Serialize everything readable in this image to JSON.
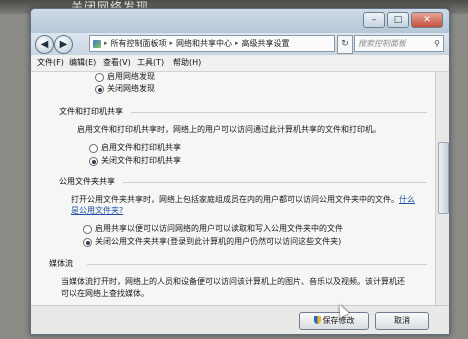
{
  "photo_caption": "，关闭网络发现",
  "window": {
    "caption_buttons": {
      "minimize": "–",
      "maximize": "□",
      "close": "✕"
    }
  },
  "nav": {
    "back": "◀",
    "forward": "▶"
  },
  "address": {
    "crumbs": [
      "所有控制面板项",
      "网络和共享中心",
      "高级共享设置"
    ],
    "separator": "▸",
    "refresh": "↻"
  },
  "search": {
    "placeholder": "搜索控制面板",
    "icon": "⚲"
  },
  "menu": [
    "文件(F)",
    "编辑(E)",
    "查看(V)",
    "工具(T)",
    "帮助(H)"
  ],
  "sections": {
    "network_discovery": {
      "options": [
        "启用网络发现",
        "关闭网络发现"
      ],
      "selected": 1
    },
    "file_printer": {
      "heading": "文件和打印机共享",
      "description": "启用文件和打印机共享时，网络上的用户可以访问通过此计算机共享的文件和打印机。",
      "options": [
        "启用文件和打印机共享",
        "关闭文件和打印机共享"
      ],
      "selected": 1
    },
    "public_folder": {
      "heading": "公用文件夹共享",
      "description_line1": "打开公用文件夹共享时，网络上包括家庭组成员在内的用户都可以访问公用文件夹中的文件。",
      "link_part1": "什么",
      "link_part2": "是公用文件夹?",
      "options": [
        "启用共享以便可以访问网络的用户可以读取和写入公用文件夹中的文件",
        "关闭公用文件夹共享(登录到此计算机的用户仍然可以访问这些文件夹)"
      ],
      "selected": 1
    },
    "media": {
      "heading": "媒体流",
      "description_line1": "当媒体流打开时，网络上的人员和设备便可以访问该计算机上的图片、音乐以及视频。该计算机还",
      "description_line2": "可以在网络上查找媒体。"
    }
  },
  "footer": {
    "save": "保存修改",
    "cancel": "取消"
  }
}
